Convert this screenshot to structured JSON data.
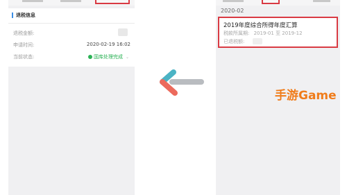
{
  "left": {
    "card_title": "退税信息",
    "rows": [
      {
        "label": "退税金额:",
        "value": ""
      },
      {
        "label": "申请时间:",
        "value": "2020-02-19 16:02"
      },
      {
        "label": "当前状态:",
        "value": "国库处理完成"
      }
    ]
  },
  "right": {
    "date_header": "2020-02",
    "summary": {
      "title": "2019年度综合所得年度汇算",
      "period_label": "税款所属期:",
      "period_value": "2019-01 至 2019-12",
      "refund_label": "已退税额:"
    }
  },
  "watermark": "手游Game",
  "colors": {
    "highlight": "#d93a43",
    "status_green": "#2bb255",
    "brand_orange": "#f07c1a",
    "accent_blue": "#3a8ee6"
  },
  "icons": [
    "back-arrow-icon",
    "status-check-icon",
    "chevron-down-icon"
  ]
}
